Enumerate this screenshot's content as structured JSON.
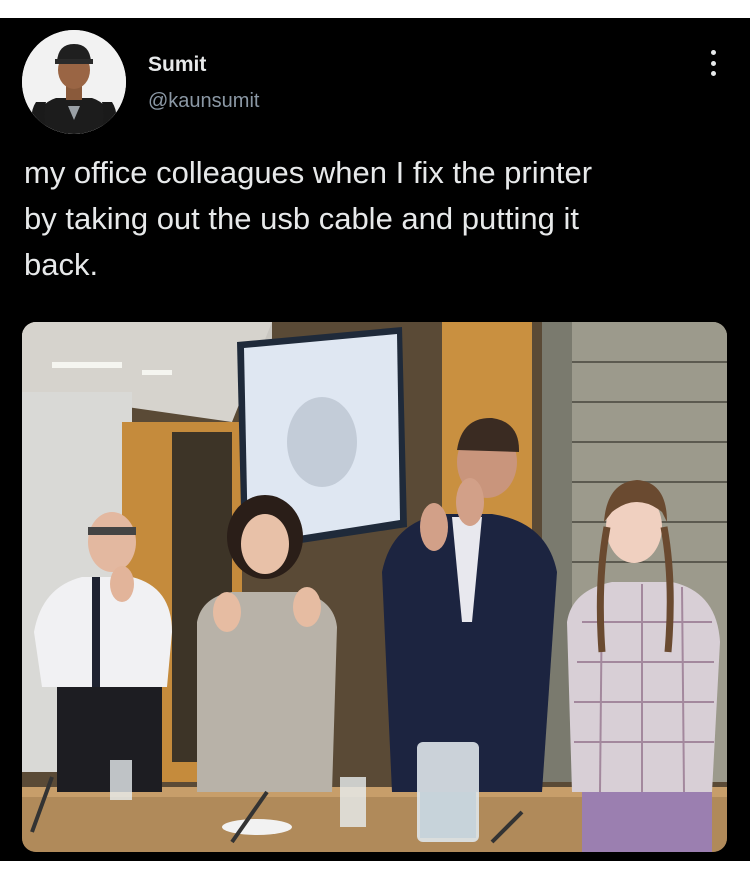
{
  "tweet": {
    "author": {
      "display_name": "Sumit",
      "handle": "@kaunsumit",
      "avatar_icon": "profile-photo"
    },
    "more_icon": "more-vertical-icon",
    "text": "my office colleagues when I fix the printer\nby taking out the usb cable and putting it\nback.",
    "media": {
      "type": "photo",
      "description_icon": "photo-meeting-applause"
    }
  },
  "colors": {
    "background": "#000000",
    "text": "#e7e9ea",
    "handle": "#8b98a5",
    "page": "#ffffff"
  }
}
